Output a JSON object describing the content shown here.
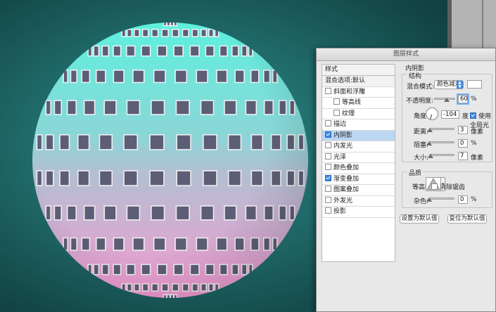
{
  "colors": {
    "sphere_top": "#5cf0de",
    "sphere_bottom": "#f49ad2",
    "background": "#1f6968",
    "window_fill": "#5d5d75",
    "accent": "#3b87e0"
  },
  "dialog": {
    "title": "图层样式",
    "styles_header": "样式",
    "blend_options": "混合选项:默认",
    "layer_styles": [
      {
        "label": "斜面和浮雕",
        "checked": false,
        "indent": false,
        "selected": false
      },
      {
        "label": "等高线",
        "checked": false,
        "indent": true,
        "selected": false
      },
      {
        "label": "纹理",
        "checked": false,
        "indent": true,
        "selected": false
      },
      {
        "label": "描边",
        "checked": false,
        "indent": false,
        "selected": false
      },
      {
        "label": "内阴影",
        "checked": true,
        "indent": false,
        "selected": true
      },
      {
        "label": "内发光",
        "checked": false,
        "indent": false,
        "selected": false
      },
      {
        "label": "光泽",
        "checked": false,
        "indent": false,
        "selected": false
      },
      {
        "label": "颜色叠加",
        "checked": false,
        "indent": false,
        "selected": false
      },
      {
        "label": "渐变叠加",
        "checked": true,
        "indent": false,
        "selected": false
      },
      {
        "label": "图案叠加",
        "checked": false,
        "indent": false,
        "selected": false
      },
      {
        "label": "外发光",
        "checked": false,
        "indent": false,
        "selected": false
      },
      {
        "label": "投影",
        "checked": false,
        "indent": false,
        "selected": false
      }
    ],
    "panel": {
      "section_title": "内阴影",
      "structure_title": "结构",
      "blend_mode_label": "混合模式:",
      "blend_mode_value": "颜色减淡",
      "opacity_label": "不透明度:",
      "opacity_value": "60",
      "opacity_unit": "%",
      "opacity_level": 0.6,
      "angle_label": "角度:",
      "angle_value": "-104",
      "angle_unit": "度",
      "global_light_label": "使用全局光",
      "global_light_checked": true,
      "distance_label": "距离:",
      "distance_value": "3",
      "distance_unit": "像素",
      "distance_level": 0.03,
      "choke_label": "阻塞:",
      "choke_value": "0",
      "choke_unit": "%",
      "choke_level": 0.0,
      "size_label": "大小:",
      "size_value": "7",
      "size_unit": "像素",
      "size_level": 0.05,
      "quality_title": "品质",
      "contour_label": "等高线:",
      "anti_alias_label": "消除锯齿",
      "anti_alias_checked": false,
      "noise_label": "杂色:",
      "noise_value": "0",
      "noise_unit": "%",
      "noise_level": 0.0,
      "set_default_button": "设置为默认值",
      "reset_default_button": "复位为默认值"
    }
  }
}
